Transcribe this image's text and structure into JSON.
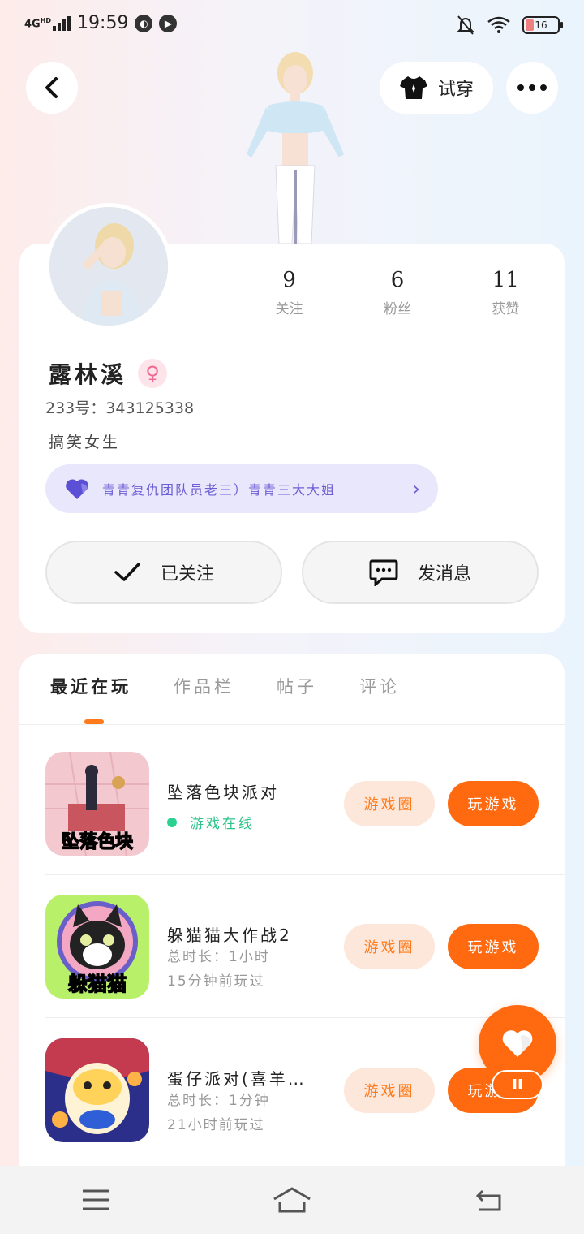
{
  "status_bar": {
    "network": "4G",
    "network_sub": "HD",
    "time": "19:59",
    "battery": "16"
  },
  "header": {
    "try_on_label": "试穿"
  },
  "profile": {
    "stats": [
      {
        "value": "9",
        "label": "关注"
      },
      {
        "value": "6",
        "label": "粉丝"
      },
      {
        "value": "11",
        "label": "获赞"
      }
    ],
    "name": "露林溪",
    "gender_symbol": "♀",
    "uid_line": "233号：343125338",
    "bio": "搞笑女生",
    "guild_text": "青青复仇团队员老三）青青三大大姐",
    "follow_label": "已关注",
    "message_label": "发消息"
  },
  "tabs": [
    {
      "label": "最近在玩",
      "active": true
    },
    {
      "label": "作品栏",
      "active": false
    },
    {
      "label": "帖子",
      "active": false
    },
    {
      "label": "评论",
      "active": false
    }
  ],
  "games": [
    {
      "title": "坠落色块派对",
      "thumb_text": "坠落色块",
      "status": "游戏在线",
      "circle_label": "游戏圈",
      "play_label": "玩游戏"
    },
    {
      "title": "躲猫猫大作战2",
      "thumb_text": "躲猫猫",
      "duration": "总时长：1小时",
      "last_played": "15分钟前玩过",
      "circle_label": "游戏圈",
      "play_label": "玩游戏"
    },
    {
      "title": "蛋仔派对(喜羊…",
      "duration": "总时长：1分钟",
      "last_played": "21小时前玩过",
      "circle_label": "游戏圈",
      "play_label": "玩游戏"
    }
  ],
  "colors": {
    "accent": "#ff6a10",
    "accent_soft": "#fde7da",
    "guild": "#6b5fd6",
    "online": "#2bc48a"
  }
}
